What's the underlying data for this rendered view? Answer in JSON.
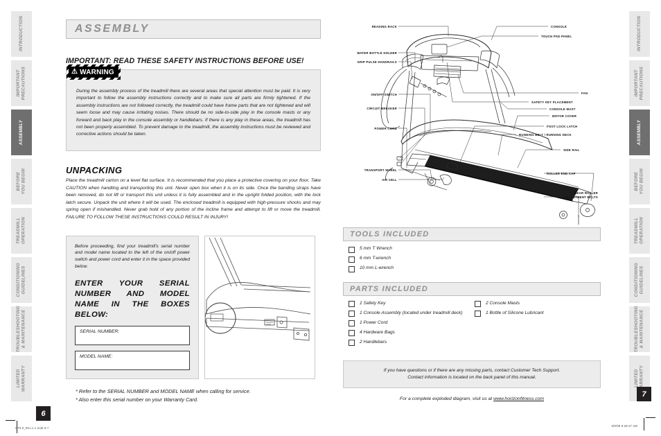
{
  "document": {
    "section_title": "ASSEMBLY",
    "left_page_number": "6",
    "right_page_number": "7",
    "print_mark_left": "CT5.0_Rev.1.1.indd   6-7",
    "print_mark_right": "6/5/08   8:28:27 AM"
  },
  "tabs": {
    "items": [
      {
        "label": "INTRODUCTION",
        "active": false
      },
      {
        "label": "IMPORTANT\nPRECAUTIONS",
        "active": false
      },
      {
        "label": "ASSEMBLY",
        "active": true
      },
      {
        "label": "BEFORE\nYOU BEGIN",
        "active": false
      },
      {
        "label": "TREADMILL\nOPERATION",
        "active": false
      },
      {
        "label": "CONDITIONING\nGUIDELINES",
        "active": false
      },
      {
        "label": "TROUBLESHOOTING\n& MAINTENANCE",
        "active": false
      },
      {
        "label": "LIMITED\nWARRANTY",
        "active": false
      }
    ]
  },
  "left_page": {
    "important_heading": "IMPORTANT:  READ THESE SAFETY INSTRUCTIONS BEFORE USE!",
    "warning": {
      "badge_label": "WARNING",
      "badge_icon": "warning-triangle-icon",
      "body": "During the assembly process of the treadmill there are several areas that special attention must be paid. It is very important to follow the assembly instructions correctly and to make sure all parts are firmly tightened.  If the assembly instructions are not followed correctly, the treadmill could have frame parts that are not tightened and will seem loose and may cause irritating noises. There should be no side-to-side play in the console masts or any forward and back play in the console assembly or handlebars. If there is any play in these areas, the treadmill has not been properly assembled. To prevent damage to the treadmill, the assembly instructions must be reviewed and corrective actions should be taken."
    },
    "unpacking": {
      "heading": "UNPACKING",
      "body": "Place the treadmill carton on a level flat surface. It is recommended that you place a protective covering on your floor. Take CAUTION when handling and transporting this unit. Never open box when it is on its side. Once the banding straps have been removed, do not lift or transport this unit unless it is fully assembled and in the upright folded position, with the lock latch secure. Unpack the unit where it will be used. The enclosed treadmill is equipped with high-pressure shocks and may spring open if mishandled. Never grab hold of any portion of the incline frame and attempt to lift or move the treadmill. FAILURE TO FOLLOW THESE INSTRUCTIONS COULD RESULT IN INJURY!"
    },
    "serial": {
      "intro": "Before proceeding,  find your treadmill's serial number and model name located to the left of the on/off power switch and power cord and enter it in the space provided below.",
      "cta": "ENTER YOUR SERIAL NUMBER AND MODEL NAME IN THE BOXES BELOW:",
      "serial_field_label": "SERIAL NUMBER:",
      "serial_field_value": "",
      "model_field_label": "MODEL NAME:",
      "model_field_value": "",
      "figure_name": "treadmill-base-serial-location-illustration"
    },
    "footnotes": [
      "* Refer to the SERIAL NUMBER and MODEL NAME when calling for service.",
      "* Also enter this serial number on your Warranty Card."
    ]
  },
  "right_page": {
    "diagram": {
      "name": "treadmill-parts-diagram",
      "labels_left": [
        "READING RACK",
        "WATER BOTTLE HOLDER",
        "GRIP PULSE HANDRAILS",
        "ON/OFF SWITCH",
        "CIRCUIT BREAKER",
        "POWER CORD",
        "TRANSPORT WHEEL",
        "AIR CELL"
      ],
      "labels_right": [
        "CONSOLE",
        "TOUCH PAD PANEL",
        "FAN",
        "SAFETY KEY PLACEMENT",
        "CONSOLE MAST",
        "MOTOR COVER",
        "FOOT LOCK LATCH",
        "RUNNING BELT / RUNNING DECK",
        "SIDE RAIL",
        "ROLLER END CAP",
        "REAR ROLLER\nADJUSTMENT BOLTS"
      ]
    },
    "tools_included": {
      "heading": "TOOLS INCLUDED",
      "items": [
        "5 mm T Wrench",
        "6 mm T-wrench",
        "10 mm L-wrench"
      ]
    },
    "parts_included": {
      "heading": "PARTS INCLUDED",
      "column1": [
        "1 Safety Key",
        "1 Console Assembly (located under treadmill deck)",
        "1 Power Cord",
        "4 Hardware Bags",
        "2 Handlebars"
      ],
      "column2": [
        "2 Console Masts",
        "1 Bottle of Silicone Lubricant"
      ]
    },
    "support": {
      "line1": "If you have questions or if there are any missing parts, contact Customer Tech Support.",
      "line2": "Contact information is located on the back panel of this manual."
    },
    "exploded": {
      "prefix": "For a complete exploded diagram, visit us at ",
      "url": "www.horizonfitness.com"
    }
  },
  "colors": {
    "banner_bg": "#ececec",
    "banner_text": "#8f8f8f",
    "tab_active_bg": "#6f6f6f",
    "tab_bg": "#e8e8e8",
    "ink": "#231f20"
  }
}
